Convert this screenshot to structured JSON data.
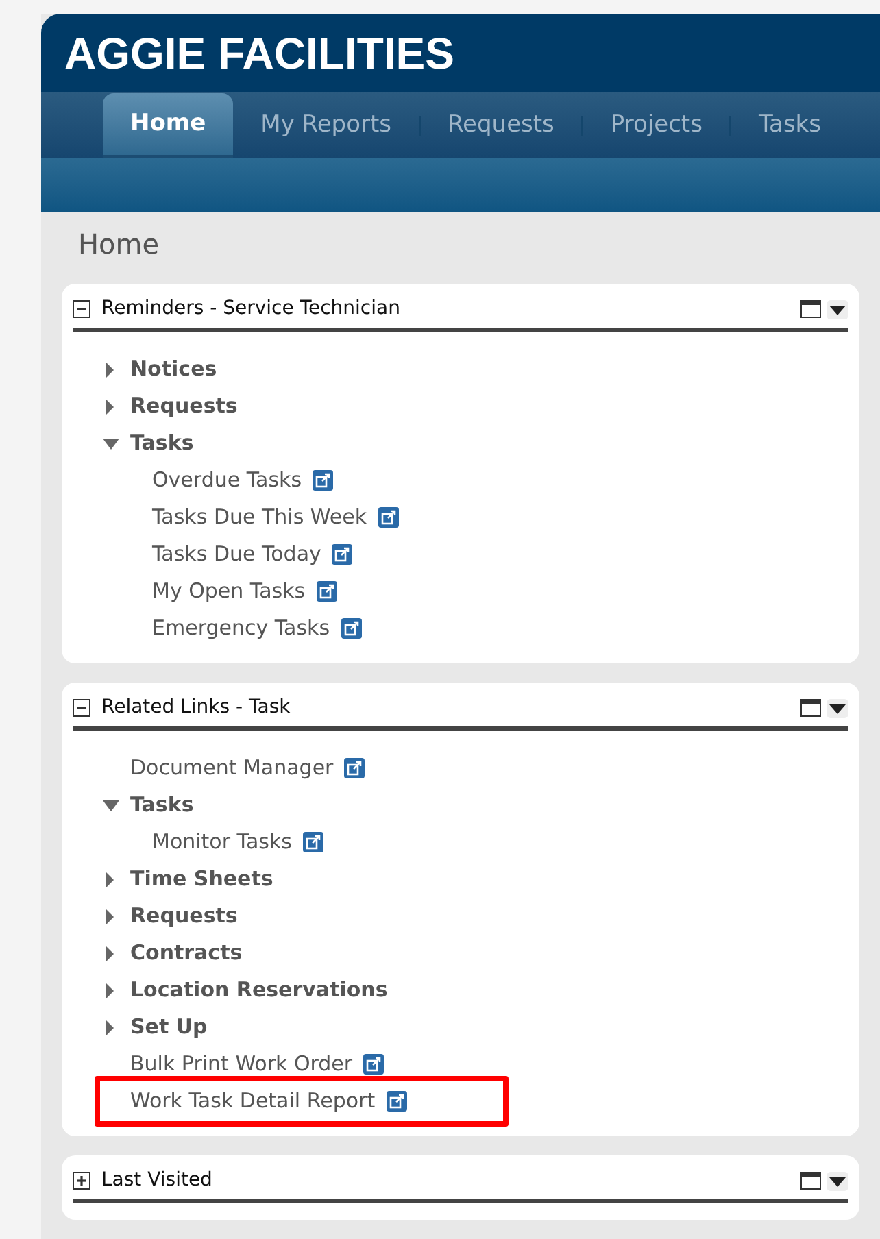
{
  "app_title": "AGGIE FACILITIES",
  "tabs": [
    {
      "label": "Home",
      "selected": true
    },
    {
      "label": "My Reports",
      "selected": false
    },
    {
      "label": "Requests",
      "selected": false
    },
    {
      "label": "Projects",
      "selected": false
    },
    {
      "label": "Tasks",
      "selected": false
    }
  ],
  "page_title": "Home",
  "panels": [
    {
      "title": "Reminders - Service Technician",
      "expanded": true,
      "items": [
        {
          "kind": "folder",
          "label": "Notices",
          "expanded": false
        },
        {
          "kind": "folder",
          "label": "Requests",
          "expanded": false
        },
        {
          "kind": "folder",
          "label": "Tasks",
          "expanded": true,
          "children": [
            {
              "kind": "link",
              "label": "Overdue Tasks",
              "highlighted": false
            },
            {
              "kind": "link",
              "label": "Tasks Due This Week",
              "highlighted": false
            },
            {
              "kind": "link",
              "label": "Tasks Due Today",
              "highlighted": false
            },
            {
              "kind": "link",
              "label": "My Open Tasks",
              "highlighted": false
            },
            {
              "kind": "link",
              "label": "Emergency Tasks",
              "highlighted": false
            }
          ]
        }
      ]
    },
    {
      "title": "Related Links - Task",
      "expanded": true,
      "items": [
        {
          "kind": "link",
          "label": "Document Manager",
          "highlighted": false
        },
        {
          "kind": "folder",
          "label": "Tasks",
          "expanded": true,
          "children": [
            {
              "kind": "link",
              "label": "Monitor Tasks",
              "highlighted": false
            }
          ]
        },
        {
          "kind": "folder",
          "label": "Time Sheets",
          "expanded": false
        },
        {
          "kind": "folder",
          "label": "Requests",
          "expanded": false
        },
        {
          "kind": "folder",
          "label": "Contracts",
          "expanded": false
        },
        {
          "kind": "folder",
          "label": "Location Reservations",
          "expanded": false
        },
        {
          "kind": "folder",
          "label": "Set Up",
          "expanded": false
        },
        {
          "kind": "link",
          "label": "Bulk Print Work Order",
          "highlighted": false
        },
        {
          "kind": "link",
          "label": "Work Task Detail Report",
          "highlighted": true
        }
      ]
    },
    {
      "title": "Last Visited",
      "expanded": false
    }
  ]
}
